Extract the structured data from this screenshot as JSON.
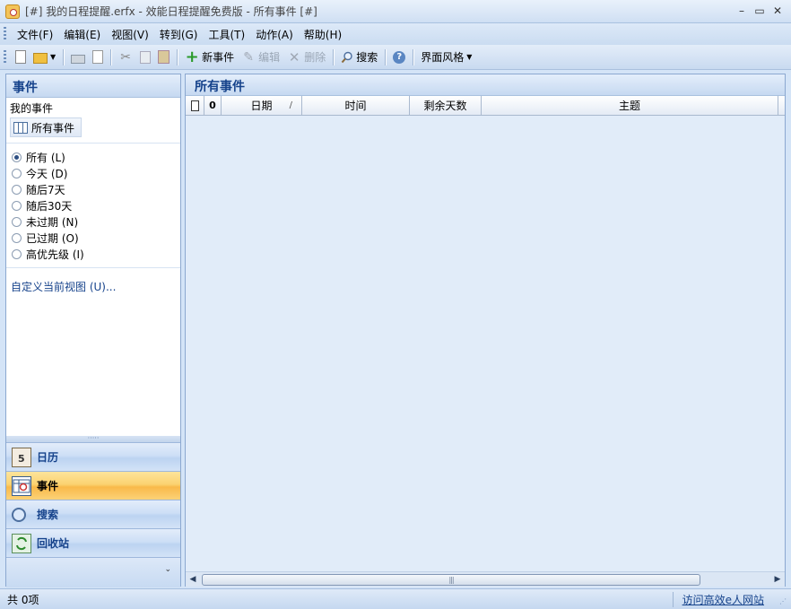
{
  "window": {
    "title": "[#] 我的日程提醒.erfx - 效能日程提醒免费版 - 所有事件 [#]",
    "minimize": "–",
    "maximize": "▭",
    "close": "✕"
  },
  "menu": {
    "items": [
      "文件(F)",
      "编辑(E)",
      "视图(V)",
      "转到(G)",
      "工具(T)",
      "动作(A)",
      "帮助(H)"
    ]
  },
  "toolbar": {
    "new_event": "新事件",
    "edit": "编辑",
    "delete": "删除",
    "search": "搜索",
    "help_icon": "?",
    "theme": "界面风格"
  },
  "left_panel": {
    "header": "事件",
    "section_title": "我的事件",
    "view_item": "所有事件",
    "filters": [
      {
        "label": "所有 (L)",
        "selected": true
      },
      {
        "label": "今天 (D)",
        "selected": false
      },
      {
        "label": "随后7天",
        "selected": false
      },
      {
        "label": "随后30天",
        "selected": false
      },
      {
        "label": "未过期 (N)",
        "selected": false
      },
      {
        "label": "已过期 (O)",
        "selected": false
      },
      {
        "label": "高优先级 (I)",
        "selected": false
      }
    ],
    "custom_view_link": "自定义当前视图 (U)...",
    "splitter_grip": "·····",
    "nav": {
      "calendar": "日历",
      "events": "事件",
      "search": "搜索",
      "recycle": "回收站",
      "calendar_day": "5",
      "footer_chevron": "⌄"
    }
  },
  "right_panel": {
    "header": "所有事件",
    "columns": {
      "attachment": "0",
      "date": "日期",
      "sort_indicator": "/",
      "time": "时间",
      "days_left": "剩余天数",
      "subject": "主题"
    },
    "scroll": {
      "left": "◀",
      "right": "▶",
      "thumb_grip": "|||"
    }
  },
  "status": {
    "left": "共 0项",
    "link": "访问高效e人网站",
    "grip": "⋰"
  }
}
